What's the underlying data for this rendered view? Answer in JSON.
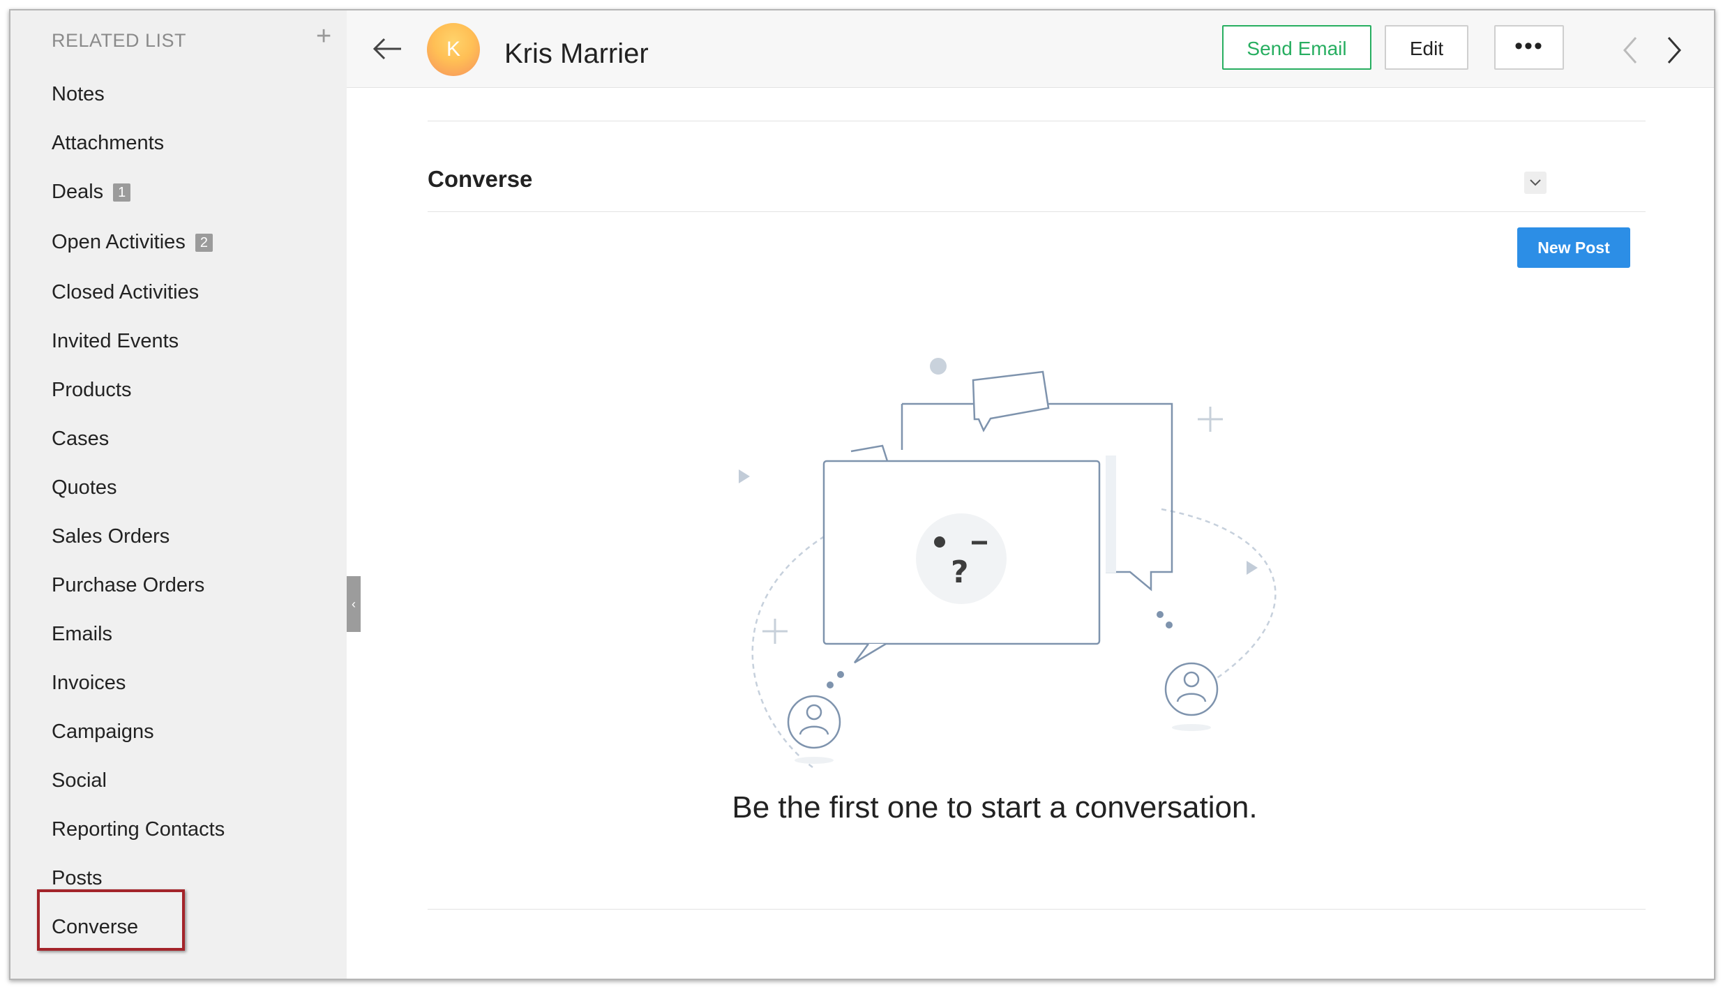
{
  "sidebar": {
    "header": "RELATED LIST",
    "add_label": "+",
    "items": [
      {
        "label": "Notes"
      },
      {
        "label": "Attachments"
      },
      {
        "label": "Deals",
        "badge": "1"
      },
      {
        "label": "Open Activities",
        "badge": "2"
      },
      {
        "label": "Closed Activities"
      },
      {
        "label": "Invited Events"
      },
      {
        "label": "Products"
      },
      {
        "label": "Cases"
      },
      {
        "label": "Quotes"
      },
      {
        "label": "Sales Orders"
      },
      {
        "label": "Purchase Orders"
      },
      {
        "label": "Emails"
      },
      {
        "label": "Invoices"
      },
      {
        "label": "Campaigns"
      },
      {
        "label": "Social"
      },
      {
        "label": "Reporting Contacts"
      },
      {
        "label": "Posts"
      },
      {
        "label": "Converse"
      }
    ],
    "highlighted_item": "Converse",
    "collapse_icon": "chevron-left-icon"
  },
  "header": {
    "back_icon": "arrow-left-icon",
    "avatar_initial": "K",
    "contact_name": "Kris Marrier",
    "send_email_label": "Send Email",
    "edit_label": "Edit",
    "more_label": "•••",
    "prev_icon": "chevron-left-icon",
    "next_icon": "chevron-right-icon"
  },
  "main": {
    "section_title": "Converse",
    "toggle_icon": "chevron-down-icon",
    "new_post_label": "New Post",
    "empty_message": "Be the first one to start a conversation.",
    "illustration_icon": "conversation-empty-illustration"
  },
  "colors": {
    "send_email_accent": "#27ae60",
    "new_post_bg": "#2c8ee6",
    "highlight_border": "#a3242a",
    "sidebar_bg": "#f0f0f0"
  }
}
